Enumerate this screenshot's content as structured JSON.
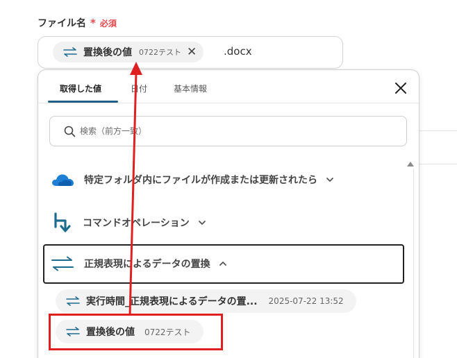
{
  "field": {
    "label": "ファイル名",
    "required_star": "*",
    "required_text": "必須",
    "token": {
      "name": "置換後の値",
      "value": "0722テスト"
    },
    "suffix": ".docx"
  },
  "popup": {
    "tabs": [
      {
        "label": "取得した値",
        "active": true
      },
      {
        "label": "日付",
        "active": false
      },
      {
        "label": "基本情報",
        "active": false
      }
    ],
    "search_placeholder": "検索（前方一致）",
    "groups": [
      {
        "label": "特定フォルダ内にファイルが作成または更新されたら",
        "icon": "onedrive-icon",
        "expanded": false
      },
      {
        "label": "コマンドオペレーション",
        "icon": "command-operation-icon",
        "expanded": false
      },
      {
        "label": "正規表現によるデータの置換",
        "icon": "swap-icon",
        "expanded": true
      }
    ],
    "items": [
      {
        "name": "実行時間_正規表現によるデータの置...",
        "value": "2025-07-22 13:52"
      },
      {
        "name": "置換後の値",
        "value": "0722テスト"
      }
    ]
  },
  "colors": {
    "accent": "#1f5f86",
    "required": "#e5484d",
    "highlight": "#e02020",
    "swap_icon": "#1e6b8e",
    "onedrive": "#1f7fd4"
  }
}
